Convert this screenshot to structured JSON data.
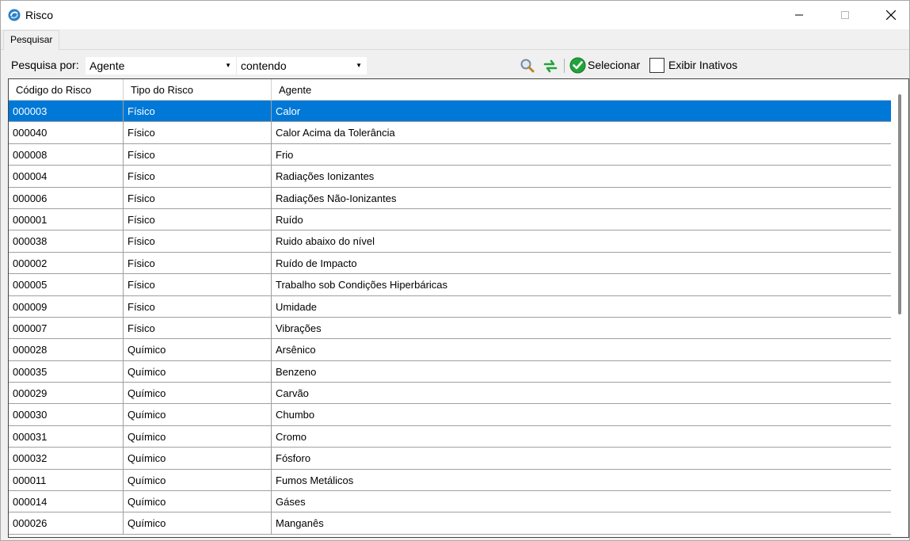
{
  "window": {
    "title": "Risco",
    "icon": "app-swirl-icon",
    "controls": [
      "minimize-icon",
      "maximize-icon",
      "close-icon"
    ]
  },
  "tabs": [
    {
      "label": "Pesquisar",
      "active": true
    }
  ],
  "search": {
    "label": "Pesquisa por:",
    "field_value": "Agente",
    "operator_value": "contendo",
    "select_label": "Selecionar",
    "show_inactive_label": "Exibir Inativos",
    "show_inactive_checked": false,
    "icons": [
      "magnifier-icon",
      "refresh-icon",
      "check-circle-icon"
    ]
  },
  "grid": {
    "columns": [
      "Código do Risco",
      "Tipo do Risco",
      "Agente"
    ],
    "selected_row": 0,
    "rows": [
      [
        "000003",
        "Físico",
        "Calor"
      ],
      [
        "000040",
        "Físico",
        "Calor Acima da Tolerância"
      ],
      [
        "000008",
        "Físico",
        "Frio"
      ],
      [
        "000004",
        "Físico",
        "Radiações Ionizantes"
      ],
      [
        "000006",
        "Físico",
        "Radiações Não-Ionizantes"
      ],
      [
        "000001",
        "Físico",
        "Ruído"
      ],
      [
        "000038",
        "Físico",
        "Ruido abaixo do nível"
      ],
      [
        "000002",
        "Físico",
        "Ruído de Impacto"
      ],
      [
        "000005",
        "Físico",
        "Trabalho sob Condições Hiperbáricas"
      ],
      [
        "000009",
        "Físico",
        "Umidade"
      ],
      [
        "000007",
        "Físico",
        "Vibrações"
      ],
      [
        "000028",
        "Químico",
        "Arsênico"
      ],
      [
        "000035",
        "Químico",
        "Benzeno"
      ],
      [
        "000029",
        "Químico",
        "Carvão"
      ],
      [
        "000030",
        "Químico",
        "Chumbo"
      ],
      [
        "000031",
        "Químico",
        "Cromo"
      ],
      [
        "000032",
        "Químico",
        "Fósforo"
      ],
      [
        "000011",
        "Químico",
        "Fumos Metálicos"
      ],
      [
        "000014",
        "Químico",
        "Gáses"
      ],
      [
        "000026",
        "Químico",
        "Manganês"
      ]
    ]
  },
  "colors": {
    "selection": "#0078d7",
    "selection_text": "#ffffff",
    "accent_green": "#22a33a"
  }
}
